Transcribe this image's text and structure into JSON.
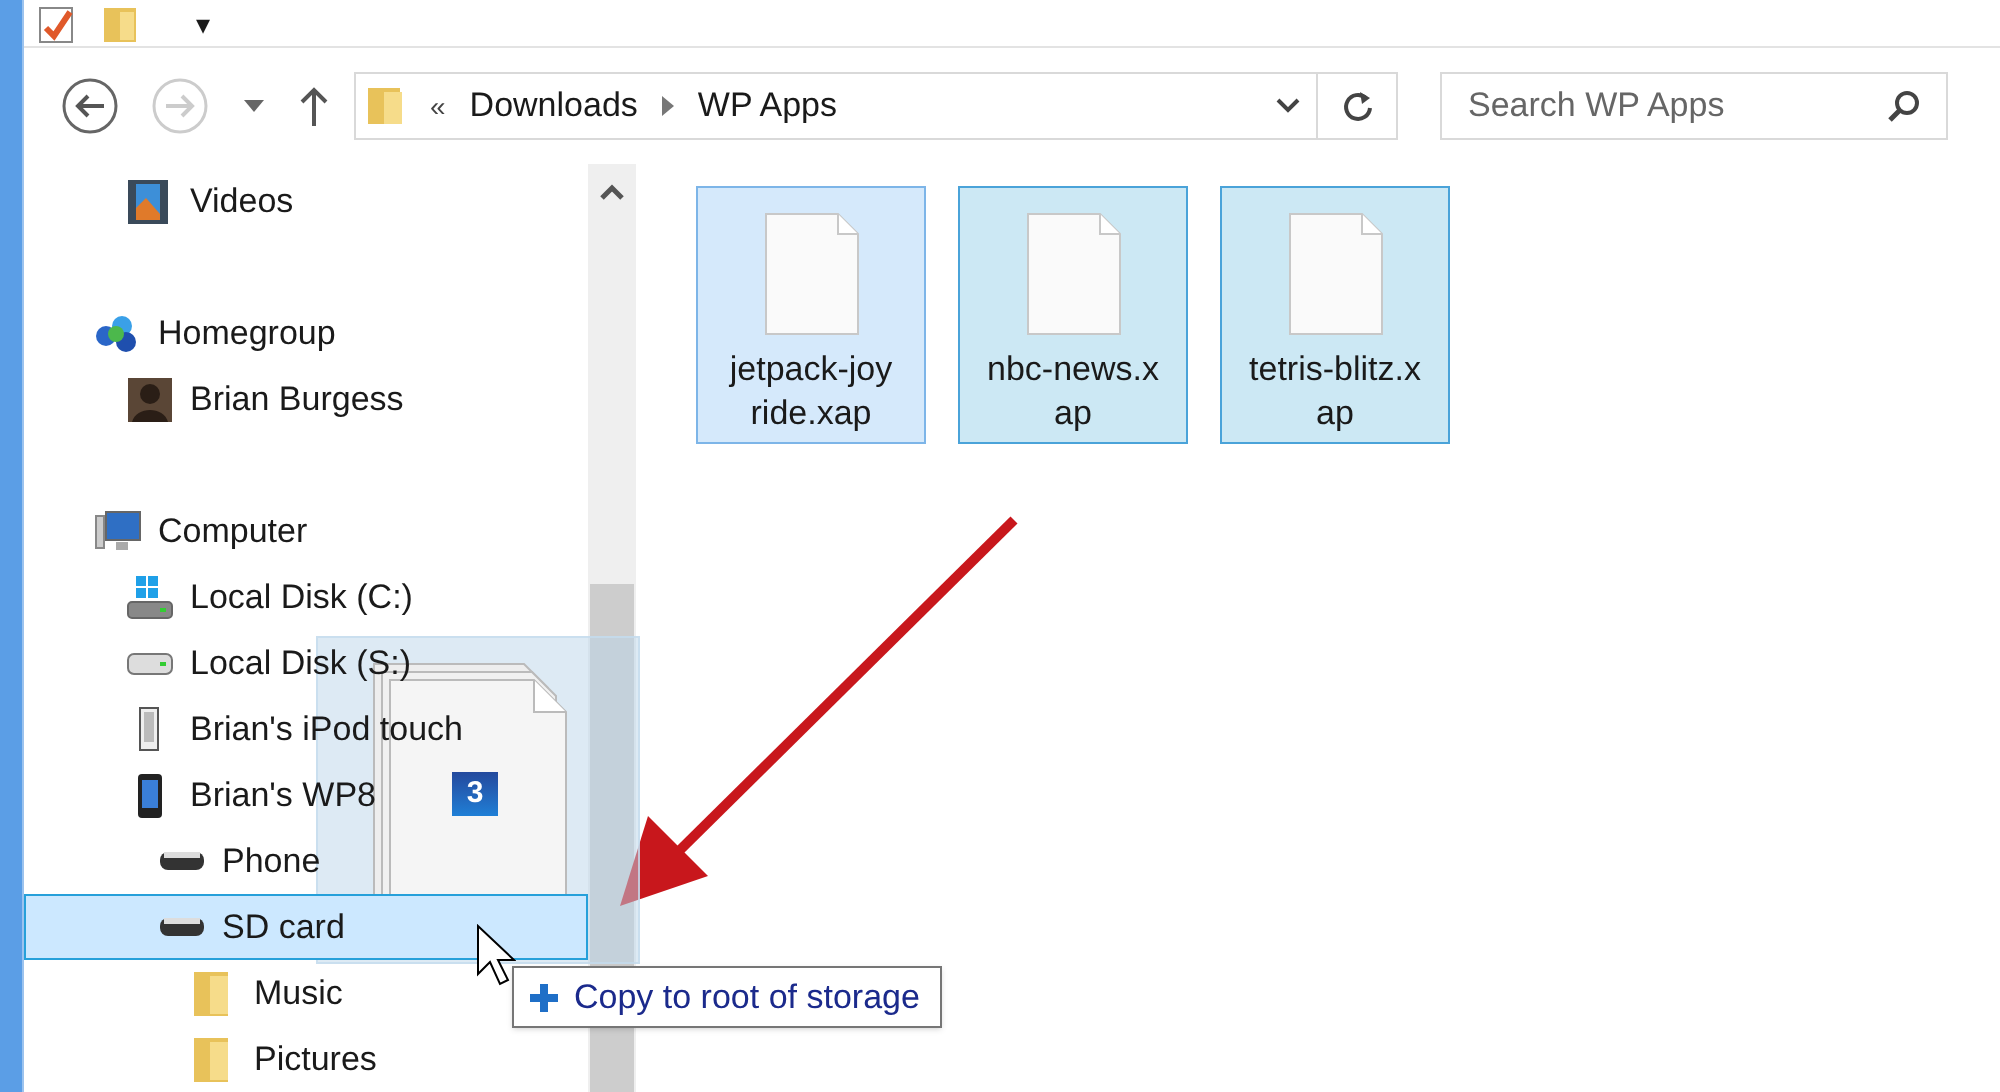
{
  "quick_access": {
    "menu_glyph": "▾"
  },
  "address_bar": {
    "overflow": "«",
    "crumbs": [
      "Downloads",
      "WP Apps"
    ]
  },
  "search": {
    "placeholder": "Search WP Apps"
  },
  "nav": {
    "items": [
      {
        "label": "Videos",
        "kind": "video",
        "continued": true,
        "selected": false
      },
      {
        "label": "Homegroup",
        "kind": "homegroup",
        "selected": false,
        "children": [
          {
            "label": "Brian Burgess",
            "kind": "user",
            "selected": false
          }
        ]
      },
      {
        "label": "Computer",
        "kind": "computer",
        "selected": false,
        "children": [
          {
            "label": "Local Disk (C:)",
            "kind": "systemdisk",
            "selected": false
          },
          {
            "label": "Local Disk (S:)",
            "kind": "disk",
            "selected": false
          },
          {
            "label": "Brian's iPod touch",
            "kind": "player",
            "selected": false
          },
          {
            "label": "Brian's WP8",
            "kind": "phone",
            "selected": false,
            "children": [
              {
                "label": "Phone",
                "kind": "storage",
                "selected": false
              },
              {
                "label": "SD card",
                "kind": "storage",
                "selected": true,
                "children": [
                  {
                    "label": "Music",
                    "kind": "folder",
                    "selected": false
                  },
                  {
                    "label": "Pictures",
                    "kind": "folder",
                    "selected": false
                  }
                ]
              }
            ]
          }
        ]
      }
    ]
  },
  "files": [
    {
      "lines": [
        "jetpack-joy",
        "ride.xap"
      ],
      "selected": true,
      "hot": true
    },
    {
      "lines": [
        "nbc-news.x",
        "ap"
      ],
      "selected": true,
      "hot": false
    },
    {
      "lines": [
        "tetris-blitz.x",
        "ap"
      ],
      "selected": true,
      "hot": false
    }
  ],
  "drag": {
    "count": "3",
    "tooltip": "Copy to root of storage"
  }
}
